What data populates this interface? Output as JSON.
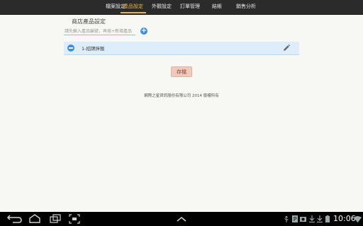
{
  "tabs": [
    {
      "label": "檔案設定"
    },
    {
      "label": "產品設定"
    },
    {
      "label": "外觀設定"
    },
    {
      "label": "訂單管理"
    },
    {
      "label": "結帳"
    },
    {
      "label": "銷售分析"
    }
  ],
  "active_tab": "產品設定",
  "section": {
    "title": "商店產品設定",
    "input_placeholder": "請先輸入產品編號，再按+新增產品"
  },
  "items": [
    {
      "label": "1-招牌拌飯"
    }
  ],
  "save_label": "存檔",
  "footer": "網際之星資訊股份有限公司 2014 版權所有",
  "status_bar": {
    "time": "10:06"
  },
  "icons": {
    "add": "plus-circle-icon",
    "remove": "minus-circle-icon",
    "edit": "pencil-icon",
    "back": "back-icon",
    "home": "home-icon",
    "recent": "recent-apps-icon",
    "screenshot": "screenshot-icon",
    "up": "chevron-up-icon",
    "usb": "usb-icon",
    "parking": "p-icon",
    "camera": "camera-icon",
    "download": "download-icon",
    "wifi": "wifi-icon",
    "battery": "battery-icon"
  },
  "colors": {
    "accent": "#f0b43a",
    "topbar": "#2b2b2b",
    "item_bg": "#ddeefa",
    "button_blue": "#3a8ee0",
    "save_bg": "#f2c9b8"
  }
}
